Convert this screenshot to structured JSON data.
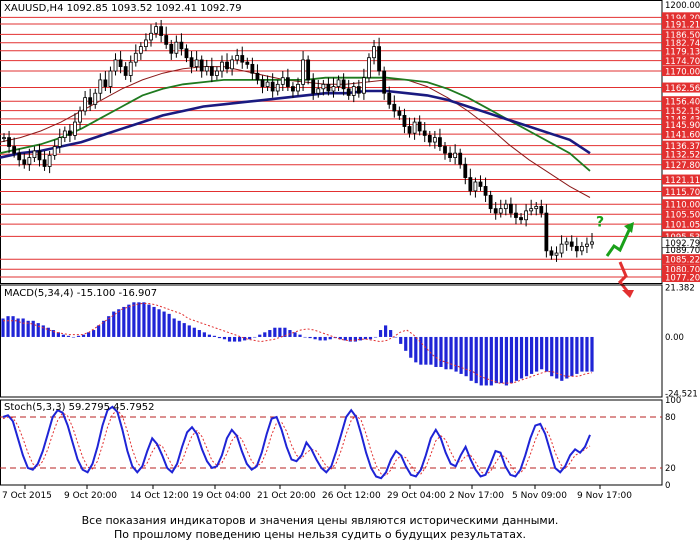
{
  "chart_data": [
    {
      "type": "candlestick",
      "symbol_header": "XAUUSD,H4  1092.85 1093.52 1092.41 1092.79",
      "ylim": [
        1074.5,
        1202.0
      ],
      "price_ticks": [
        "1200.00",
        "1194.20",
        "1191.21",
        "1186.50",
        "1182.74",
        "1179.13",
        "1174.70",
        "1170.00",
        "1162.56",
        "1156.40",
        "1152.15",
        "1148.43",
        "1145.90",
        "1141.60",
        "1136.37",
        "1132.52",
        "1127.80",
        "1121.11",
        "1115.70",
        "1110.00",
        "1105.50",
        "1101.05",
        "1095.53",
        "1092.79",
        "1089.70",
        "1085.22",
        "1080.70",
        "1077.20"
      ],
      "horizontal_levels": [
        1194.2,
        1191.21,
        1186.5,
        1182.74,
        1179.13,
        1174.7,
        1170.0,
        1162.56,
        1156.4,
        1152.15,
        1148.43,
        1145.9,
        1141.6,
        1136.37,
        1132.52,
        1127.8,
        1121.11,
        1115.7,
        1110.0,
        1105.5,
        1101.05,
        1095.53,
        1085.22,
        1080.7,
        1077.2
      ],
      "current_price": "1092.79",
      "x_labels": [
        "7 Oct 2015",
        "9 Oct 20:00",
        "14 Oct 12:00",
        "19 Oct 04:00",
        "21 Oct 20:00",
        "26 Oct 12:00",
        "29 Oct 04:00",
        "2 Nov 17:00",
        "5 Nov 09:00",
        "9 Nov 17:00"
      ],
      "close_path": [
        1140,
        1136,
        1133,
        1130,
        1128,
        1131,
        1134,
        1130,
        1127,
        1132,
        1136,
        1140,
        1143,
        1141,
        1147,
        1152,
        1158,
        1155,
        1160,
        1166,
        1163,
        1170,
        1175,
        1172,
        1168,
        1174,
        1178,
        1181,
        1184,
        1187,
        1190,
        1186,
        1182,
        1178,
        1183,
        1180,
        1176,
        1172,
        1175,
        1170,
        1172,
        1168,
        1170,
        1174,
        1171,
        1175,
        1177,
        1174,
        1173,
        1169,
        1166,
        1163,
        1165,
        1161,
        1164,
        1167,
        1163,
        1161,
        1164,
        1175,
        1166,
        1160,
        1162,
        1164,
        1161,
        1163,
        1166,
        1162,
        1159,
        1163,
        1160,
        1167,
        1176,
        1181,
        1170,
        1160,
        1155,
        1152,
        1150,
        1145,
        1142,
        1147,
        1143,
        1141,
        1138,
        1140,
        1136,
        1133,
        1131,
        1133,
        1128,
        1122,
        1116,
        1120,
        1118,
        1114,
        1108,
        1106,
        1108,
        1110,
        1106,
        1104,
        1103,
        1107,
        1108,
        1109,
        1106,
        1089,
        1087,
        1088,
        1092,
        1093,
        1091,
        1089,
        1091,
        1092,
        1093
      ],
      "ma_series": [
        {
          "color": "#8b1a1a",
          "values": [
            1138,
            1140,
            1143,
            1147,
            1152,
            1157,
            1162,
            1166,
            1169,
            1171,
            1172,
            1172,
            1170,
            1168,
            1166,
            1165,
            1164,
            1164,
            1165,
            1166,
            1166,
            1163,
            1158,
            1152,
            1145,
            1137,
            1130,
            1124,
            1118,
            1113
          ]
        },
        {
          "color": "#1f7a1f",
          "values": [
            1133,
            1135,
            1137,
            1140,
            1144,
            1149,
            1154,
            1159,
            1162,
            1164,
            1165,
            1166,
            1166,
            1166,
            1166,
            1166,
            1167,
            1167,
            1167,
            1167,
            1166,
            1165,
            1162,
            1158,
            1153,
            1148,
            1143,
            1138,
            1133,
            1125
          ]
        },
        {
          "color": "#1a1a80",
          "values": [
            1131,
            1133,
            1134,
            1136,
            1138,
            1141,
            1144,
            1147,
            1150,
            1152,
            1154,
            1155,
            1156,
            1157,
            1158,
            1159,
            1160,
            1160,
            1161,
            1161,
            1160,
            1159,
            1157,
            1154,
            1151,
            1148,
            1145,
            1142,
            1139,
            1133
          ]
        }
      ],
      "signals": [
        {
          "symbol": "?",
          "color": "#1aa01a"
        }
      ]
    },
    {
      "type": "histogram",
      "label": "MACD(5,34,4) -15.100 -16.907",
      "ylim": [
        -26,
        22.5
      ],
      "ticks": [
        "21.382",
        "0.00",
        "-24.521"
      ],
      "values": [
        8,
        9,
        9,
        8,
        8,
        7,
        7,
        6,
        5,
        4,
        3,
        2,
        1,
        0.5,
        0,
        0.5,
        1,
        2,
        3,
        5,
        7,
        9,
        11,
        12,
        13,
        14,
        15,
        15,
        15,
        14,
        13,
        12,
        11,
        10,
        8,
        7,
        6,
        5,
        4,
        3,
        2,
        1,
        0.5,
        -0.5,
        -1,
        -2,
        -2,
        -2,
        -1.5,
        -1,
        0,
        1,
        2,
        3,
        4,
        4,
        4,
        3,
        2,
        1,
        0,
        -0.5,
        -1,
        -1.5,
        -1.5,
        -1,
        -0.5,
        -1,
        -1.5,
        -2,
        -2,
        -1.5,
        -1,
        -1,
        0,
        3,
        5,
        3,
        0,
        -3,
        -6,
        -9,
        -11,
        -12,
        -12,
        -12,
        -13,
        -13,
        -14,
        -14,
        -15,
        -16,
        -17,
        -19,
        -20,
        -21,
        -21,
        -21,
        -20,
        -20,
        -21,
        -20,
        -19,
        -18,
        -17,
        -16,
        -15,
        -14,
        -15,
        -17,
        -18,
        -19,
        -18,
        -17,
        -16,
        -15,
        -15,
        -15
      ],
      "signal": [
        7,
        7,
        7,
        6,
        6,
        5,
        4,
        3,
        2,
        1.5,
        1,
        1,
        1,
        2,
        4,
        6,
        8,
        10,
        12,
        13,
        14,
        14.5,
        14.5,
        14,
        13,
        12,
        11,
        10,
        8,
        7,
        6,
        5,
        4,
        3,
        2,
        1,
        0,
        -1,
        -1.5,
        -2,
        -1.5,
        -1,
        0,
        1,
        2,
        3,
        3.5,
        3,
        2,
        1,
        0,
        -1,
        -1.5,
        -1.5,
        -1,
        -1,
        -1.5,
        -2,
        -1.5,
        0,
        2,
        3,
        1,
        -2,
        -5,
        -8,
        -10,
        -11,
        -12,
        -13,
        -14,
        -15,
        -17,
        -18,
        -19,
        -20,
        -20,
        -20,
        -19,
        -18,
        -17,
        -16,
        -15,
        -15,
        -16,
        -17,
        -17,
        -17,
        -16,
        -15.5
      ]
    },
    {
      "type": "line",
      "label": "Stoch(5,3,3) 59.2795 45.7952",
      "ylim": [
        0,
        100
      ],
      "ticks": [
        "100",
        "80",
        "20",
        "0"
      ],
      "levels": [
        80,
        20
      ],
      "k": [
        80,
        82,
        75,
        55,
        35,
        20,
        18,
        25,
        40,
        60,
        80,
        88,
        85,
        70,
        50,
        30,
        18,
        15,
        25,
        45,
        70,
        88,
        92,
        86,
        65,
        40,
        22,
        15,
        22,
        40,
        55,
        48,
        35,
        20,
        15,
        25,
        45,
        62,
        68,
        60,
        42,
        28,
        20,
        22,
        35,
        55,
        65,
        58,
        40,
        25,
        18,
        22,
        38,
        60,
        78,
        80,
        65,
        45,
        30,
        28,
        35,
        50,
        42,
        30,
        20,
        15,
        22,
        40,
        60,
        80,
        88,
        80,
        60,
        38,
        20,
        10,
        8,
        15,
        30,
        40,
        35,
        22,
        12,
        10,
        18,
        35,
        55,
        65,
        55,
        38,
        25,
        22,
        35,
        45,
        30,
        18,
        10,
        12,
        25,
        40,
        38,
        22,
        12,
        10,
        18,
        35,
        55,
        70,
        72,
        60,
        40,
        20,
        15,
        22,
        35,
        42,
        38,
        45,
        59
      ],
      "d": [
        78,
        80,
        79,
        70,
        55,
        38,
        25,
        21,
        28,
        42,
        60,
        76,
        85,
        81,
        68,
        50,
        33,
        21,
        19,
        28,
        47,
        68,
        83,
        88,
        81,
        63,
        42,
        26,
        20,
        26,
        39,
        48,
        46,
        34,
        23,
        20,
        28,
        44,
        58,
        64,
        57,
        43,
        29,
        23,
        26,
        37,
        52,
        59,
        54,
        41,
        28,
        22,
        26,
        40,
        59,
        73,
        74,
        63,
        47,
        35,
        31,
        38,
        42,
        40,
        31,
        22,
        19,
        26,
        41,
        60,
        76,
        82,
        76,
        60,
        40,
        23,
        13,
        11,
        18,
        29,
        35,
        32,
        23,
        15,
        13,
        21,
        36,
        52,
        58,
        53,
        39,
        28,
        27,
        34,
        35,
        27,
        16,
        12,
        16,
        26,
        35,
        33,
        24,
        15,
        14,
        21,
        36,
        53,
        66,
        67,
        56,
        38,
        25,
        19,
        26,
        35,
        38,
        42,
        46
      ]
    }
  ],
  "disclaimer": {
    "line1": "Все показания индикаторов и значения цены являются историческими данными.",
    "line2": "По прошлому поведению цены нельзя судить о будущих результатах."
  }
}
